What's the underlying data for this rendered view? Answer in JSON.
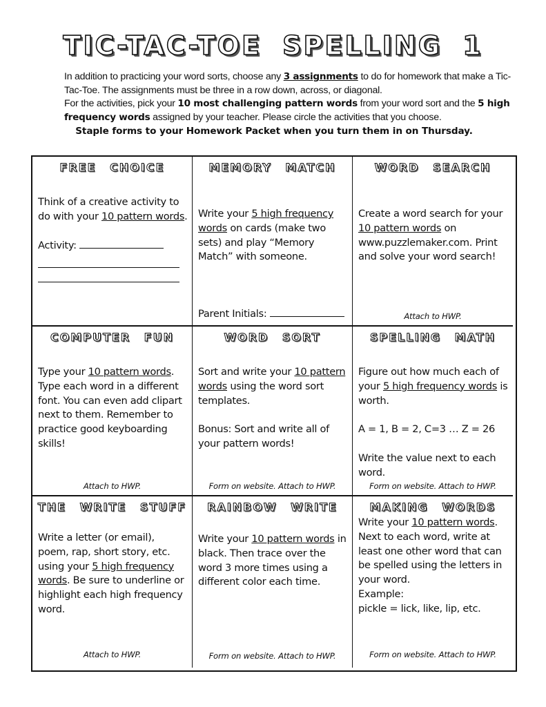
{
  "title": "TIC-TAC-TOE SPELLING 1",
  "intro": {
    "p1_pre": "In addition to practicing your word sorts, choose any ",
    "p1_bold": "3 assignments",
    "p1_post": " to do for homework that make a Tic-Tac-Toe.  The assignments must be three in a row down, across, or diagonal.",
    "p2_pre": "For the activities, pick your ",
    "p2_bold1": "10 most challenging pattern words",
    "p2_mid1": " from your word sort and the ",
    "p2_bold2": "5 high frequency words",
    "p2_post": " assigned by your teacher.  Please circle the activities that you choose.",
    "staple": "Staple forms to your Homework Packet when you turn them in on Thursday."
  },
  "cells": [
    {
      "title": "FREE CHOICE",
      "t1": "Think of a creative activity to do with your ",
      "u1": "10 pattern words",
      "t2": ".",
      "activity_label": "Activity: ",
      "activity_value": ""
    },
    {
      "title": "MEMORY MATCH",
      "t1": "Write your ",
      "u1": "5 high frequency words",
      "t2": " on cards (make two sets) and play “Memory Match” with someone.",
      "parent_label": "Parent Initials: ",
      "parent_value": ""
    },
    {
      "title": "WORD SEARCH",
      "t1": "Create a word search for your ",
      "u1": "10 pattern words",
      "t2": " on www.puzzlemaker.com.  Print and solve your word search!",
      "footer": "Attach to HWP."
    },
    {
      "title": "COMPUTER FUN",
      "t1": "Type your ",
      "u1": "10 pattern words",
      "t2": ".  Type each word in a different font. You can even add clipart next to them.  Remember to practice good keyboarding skills!",
      "footer": "Attach to HWP."
    },
    {
      "title": "WORD SORT",
      "t1": "Sort and write your ",
      "u1": "10 pattern words",
      "t2": " using the word sort templates.",
      "bonus": "Bonus: Sort and write all of your pattern words!",
      "footer": "Form on website.  Attach to HWP."
    },
    {
      "title": "SPELLING MATH",
      "t1": "Figure out how much each of your ",
      "u1": "5 high frequency words",
      "t2": " is worth.",
      "formula": "A = 1, B = 2, C=3 … Z = 26",
      "t3": "Write the value next to each word.",
      "footer": "Form on website.  Attach to HWP."
    },
    {
      "title": "THE WRITE STUFF",
      "t1": "Write a letter (or email), poem, rap, short story, etc. using your ",
      "u1": "5  high frequency words",
      "t2": ".  Be sure to underline or highlight each high frequency word.",
      "footer": "Attach to HWP."
    },
    {
      "title": "RAINBOW WRITE",
      "t1": "Write your ",
      "u1": "10 pattern words",
      "t2": " in black.  Then trace over the word 3 more times using a different color each time.",
      "footer": "Form on website.  Attach to HWP."
    },
    {
      "title": "MAKING WORDS",
      "t1": "Write your ",
      "u1": "10 pattern words",
      "t2": ".  Next to each word, write at least one other word that can be spelled using the letters in your word.",
      "example_label": "Example:",
      "example": "pickle = lick, like, lip, etc.",
      "footer": "Form on website.  Attach to HWP."
    }
  ]
}
